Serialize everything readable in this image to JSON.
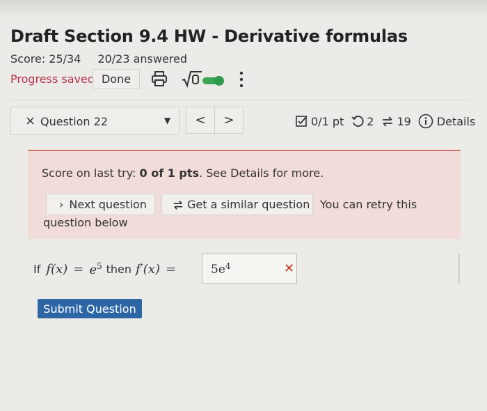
{
  "header": {
    "title": "Draft Section 9.4 HW - Derivative formulas",
    "score": "Score: 25/34",
    "answered": "20/23 answered",
    "progress_status": "Progress saved",
    "done_label": "Done"
  },
  "icons": {
    "print": "printer-icon",
    "math_input": "sqrt-icon",
    "toggle": "toggle-switch",
    "more": "kebab-menu-icon"
  },
  "question_nav": {
    "status_mark": "×",
    "question_label": "Question 22",
    "prev": "<",
    "next": ">"
  },
  "status": {
    "points": "0/1 pt",
    "retries": "2",
    "similar_count": "19",
    "details_label": "Details"
  },
  "alert": {
    "prefix": "Score on last try: ",
    "score": "0 of 1 pts",
    "suffix": ". See Details for more.",
    "next_question_label": "Next question",
    "similar_question_label": "Get a similar question",
    "retry_text_1": "You can retry this",
    "retry_text_2": "question below"
  },
  "question": {
    "lead": "If",
    "fx": "f(x)",
    "rhs_base": "e",
    "rhs_exp": "5",
    "then": "then",
    "fpx": "f′(x)",
    "answer_base": "5e",
    "answer_exp": "4",
    "result_mark": "✕"
  },
  "actions": {
    "submit_label": "Submit Question"
  },
  "colors": {
    "accent_pink": "#b5334a",
    "alert_bg": "#f1dcd9",
    "alert_border": "#d9726a",
    "submit_bg": "#2c66a5",
    "toggle_green": "#3aa655",
    "wrong_red": "#c0392b"
  }
}
